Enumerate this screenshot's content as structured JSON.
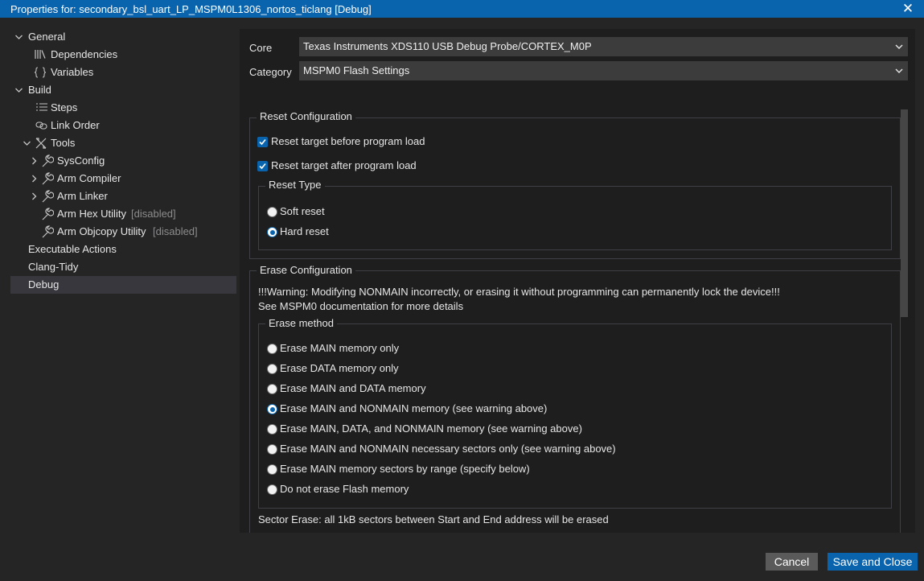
{
  "window": {
    "title": "Properties for: secondary_bsl_uart_LP_MSPM0L1306_nortos_ticlang [Debug]",
    "close_glyph": "✕"
  },
  "sidebar": {
    "items": [
      {
        "label": "General",
        "icon": "chevron-down"
      },
      {
        "label": "Dependencies",
        "icon": "library-icon"
      },
      {
        "label": "Variables",
        "icon": "variable-icon"
      },
      {
        "label": "Build",
        "icon": "chevron-down"
      },
      {
        "label": "Steps",
        "icon": "list-icon"
      },
      {
        "label": "Link Order",
        "icon": "link-icon"
      },
      {
        "label": "Tools",
        "icon": "tools-icon"
      },
      {
        "label": "SysConfig",
        "icon": "wrench-icon"
      },
      {
        "label": "Arm Compiler",
        "icon": "wrench-icon"
      },
      {
        "label": "Arm Linker",
        "icon": "wrench-icon"
      },
      {
        "label": "Arm Hex Utility",
        "suffix": "[disabled]",
        "icon": "wrench-icon"
      },
      {
        "label": "Arm Objcopy Utility",
        "suffix": "[disabled]",
        "icon": "wrench-icon"
      },
      {
        "label": "Executable Actions"
      },
      {
        "label": "Clang-Tidy"
      },
      {
        "label": "Debug",
        "selected": true
      }
    ]
  },
  "form": {
    "core_label": "Core",
    "core_value": "Texas Instruments XDS110 USB Debug Probe/CORTEX_M0P",
    "category_label": "Category",
    "category_value": "MSPM0 Flash Settings"
  },
  "reset": {
    "legend": "Reset Configuration",
    "before_load": "Reset target before program load",
    "after_load": "Reset target after program load",
    "type_legend": "Reset Type",
    "soft": "Soft reset",
    "hard": "Hard reset",
    "selected": "hard"
  },
  "erase": {
    "legend": "Erase Configuration",
    "warning": "!!!Warning: Modifying NONMAIN incorrectly, or erasing it without programming can permanently lock the device!!!",
    "doc_note": "See MSPM0 documentation for more details",
    "method_legend": "Erase method",
    "options": [
      "Erase MAIN memory only",
      "Erase DATA memory only",
      "Erase MAIN and DATA memory",
      "Erase MAIN and NONMAIN memory (see warning above)",
      "Erase MAIN, DATA, and NONMAIN memory (see warning above)",
      "Erase MAIN and NONMAIN necessary sectors only (see warning above)",
      "Erase MAIN memory sectors by range (specify below)",
      "Do not erase Flash memory"
    ],
    "selected_index": 3,
    "sector_note": "Sector Erase: all 1kB sectors between Start and End address will be erased"
  },
  "buttons": {
    "cancel": "Cancel",
    "save": "Save and Close"
  },
  "colors": {
    "accent": "#0a64ad",
    "background": "#252526",
    "panel": "#1e1e1e"
  }
}
